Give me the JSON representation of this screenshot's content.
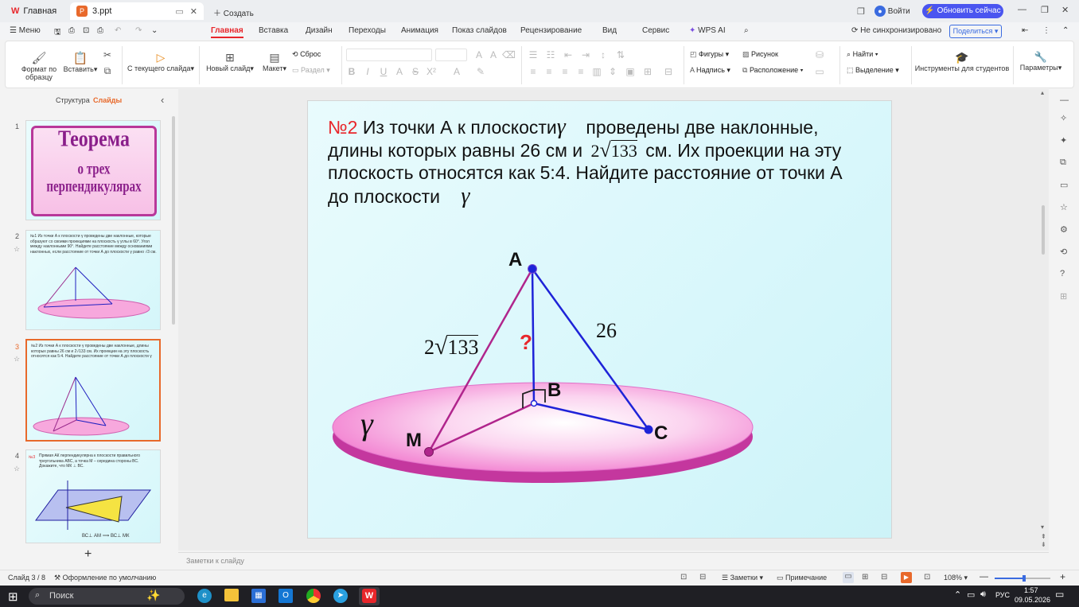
{
  "titlebar": {
    "home_tab": "Главная",
    "file_tab": "3.ppt",
    "new_tab": "Создать",
    "login": "Войти",
    "update": "Обновить сейчас"
  },
  "menu": {
    "menu_label": "Меню",
    "items": [
      "Главная",
      "Вставка",
      "Дизайн",
      "Переходы",
      "Анимация",
      "Показ слайдов",
      "Рецензирование",
      "Вид",
      "Сервис"
    ],
    "wps_ai": "WPS AI",
    "sync": "Не синхронизировано",
    "share": "Поделиться"
  },
  "ribbon": {
    "format_painter": "Формат по образцу",
    "paste": "Вставить",
    "from_current": "С текущего слайда",
    "new_slide": "Новый слайд",
    "layout": "Макет",
    "reset": "Сброс",
    "section": "Раздел",
    "shapes": "Фигуры",
    "picture": "Рисунок",
    "caption": "Надпись",
    "arrange": "Расположение",
    "find": "Найти",
    "select": "Выделение",
    "student_tools": "Инструменты для студентов",
    "params": "Параметры"
  },
  "leftpane": {
    "tab_structure": "Структура",
    "tab_slides": "Слайды",
    "nums": [
      "1",
      "2",
      "3",
      "4"
    ],
    "thumb1_line1": "Теорема",
    "thumb1_line2": "о трех перпендикулярах",
    "thumb2_text": "№1 Из точки А к плоскости γ проведены две наклонные, которые образуют со своими проекциями на плоскость γ углы в 60°. Угол между наклонными 90°. Найдите расстояние между основаниями наклонных, если расстояние от точки А до плоскости γ равно √3 см.",
    "thumb3_text": "№2 Из точки А к плоскости γ проведены две наклонные, длины которых равны 26 см и 2√133 см. Их проекции на эту плоскость относятся как 5:4. Найдите расстояние от точки А до плоскости γ",
    "thumb4_text": "Прямая АК перпендикулярна к плоскости правильного треугольника АВС, а точка М – середина стороны ВС. Докажите, что МК ⊥ ВС.",
    "thumb4_num": "№3",
    "thumb4_bottom": "ВС⊥ АМ  ⟹  ВС⊥ МК"
  },
  "slide": {
    "num": "№2",
    "line1": "Из точки А к плоскости",
    "line1b": "проведены две наклонные,",
    "line2a": "длины которых равны 26 см и",
    "line2b": "см. Их проекции на эту",
    "line3": "плоскость относятся как 5:4. Найдите расстояние от точки А",
    "line4": "до плоскости",
    "gamma": "γ",
    "sqrt_coef": "2",
    "sqrt_arg": "133",
    "label_A": "A",
    "label_B": "B",
    "label_C": "C",
    "label_M": "M",
    "len_AC": "26",
    "question": "?"
  },
  "notes": {
    "placeholder": "Заметки к слайду"
  },
  "status": {
    "slide_info": "Слайд 3 / 8",
    "theme": "Оформление по умолчанию",
    "notes": "Заметки",
    "comment": "Примечание",
    "zoom": "108%"
  },
  "taskbar": {
    "search": "Поиск",
    "lang": "РУС",
    "time": "1:57",
    "date": "09.05.2026"
  },
  "colors": {
    "accent": "#3a6be0",
    "wps_red": "#e8262b",
    "pink": "#f4a3da",
    "update_bg": "#4a55f0"
  }
}
